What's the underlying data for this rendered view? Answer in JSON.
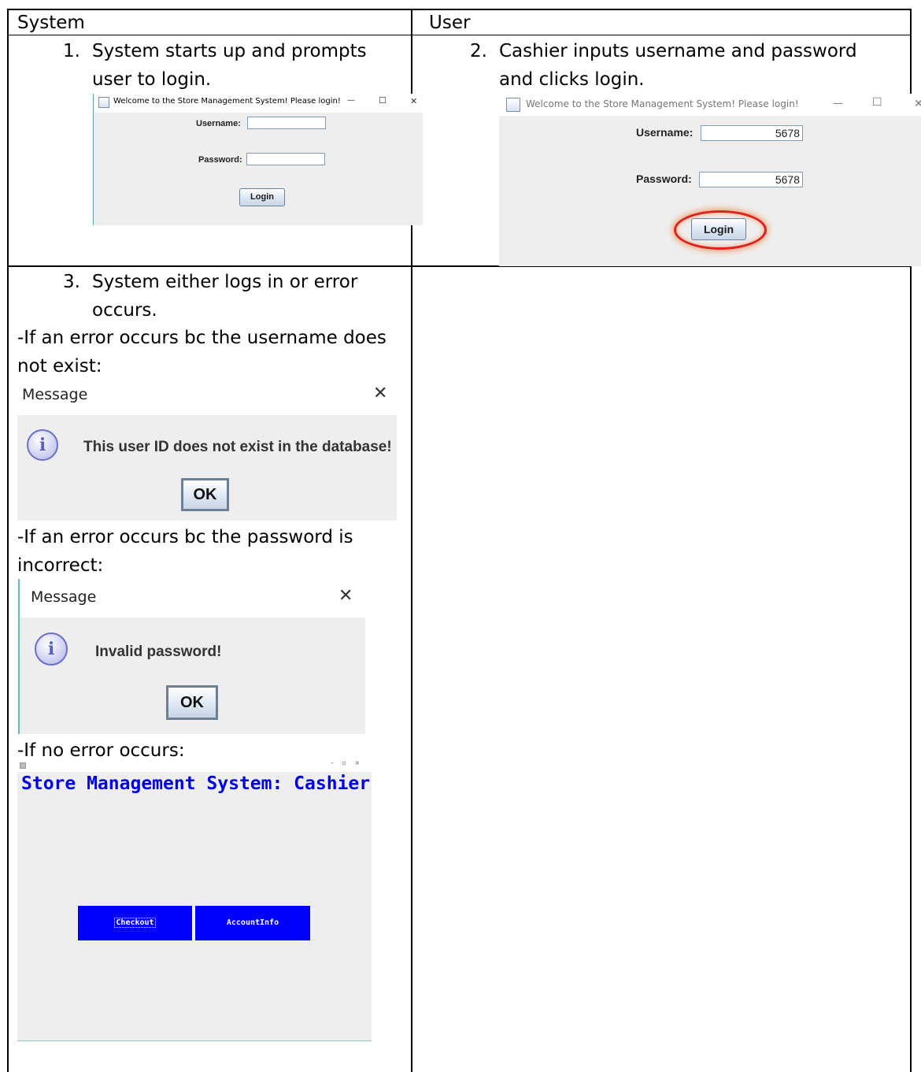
{
  "table": {
    "headers": [
      "System",
      "User"
    ]
  },
  "steps": {
    "step1": {
      "num": "1.",
      "line1": "System starts up and prompts",
      "line2": "user to login."
    },
    "step2": {
      "num": "2.",
      "line1": "Cashier inputs username and password",
      "line2": "and clicks login."
    },
    "step3": {
      "num": "3.",
      "line1": "System either logs in or error",
      "line2": "occurs."
    }
  },
  "notes": {
    "no_user_line1": "-If an error occurs bc the username does",
    "no_user_line2": "not exist:",
    "bad_pw_line1": "-If an error occurs bc the password is",
    "bad_pw_line2": "incorrect:",
    "no_error": "-If no error occurs:"
  },
  "login_window": {
    "title": "Welcome to the Store Management System! Please login!",
    "username_label": "Username:",
    "password_label": "Password:",
    "login_button": "Login",
    "minimize": "—",
    "maximize": "☐",
    "close": "✕"
  },
  "login_window_filled": {
    "username_value": "5678",
    "password_value": "5678",
    "highlight_color": "#e0201a"
  },
  "dialog_no_user": {
    "title": "Message",
    "close": "✕",
    "icon": "i",
    "message": "This user ID does not exist in the database!",
    "ok": "OK"
  },
  "dialog_bad_pw": {
    "title": "Message",
    "close": "✕",
    "icon": "i",
    "message": "Invalid password!",
    "ok": "OK"
  },
  "cashier_window": {
    "title": "Store Management System: Cashier",
    "window_controls": "– ▫ ×",
    "buttons": [
      "Checkout",
      "AccountInfo"
    ],
    "accent": "#0000ff"
  }
}
